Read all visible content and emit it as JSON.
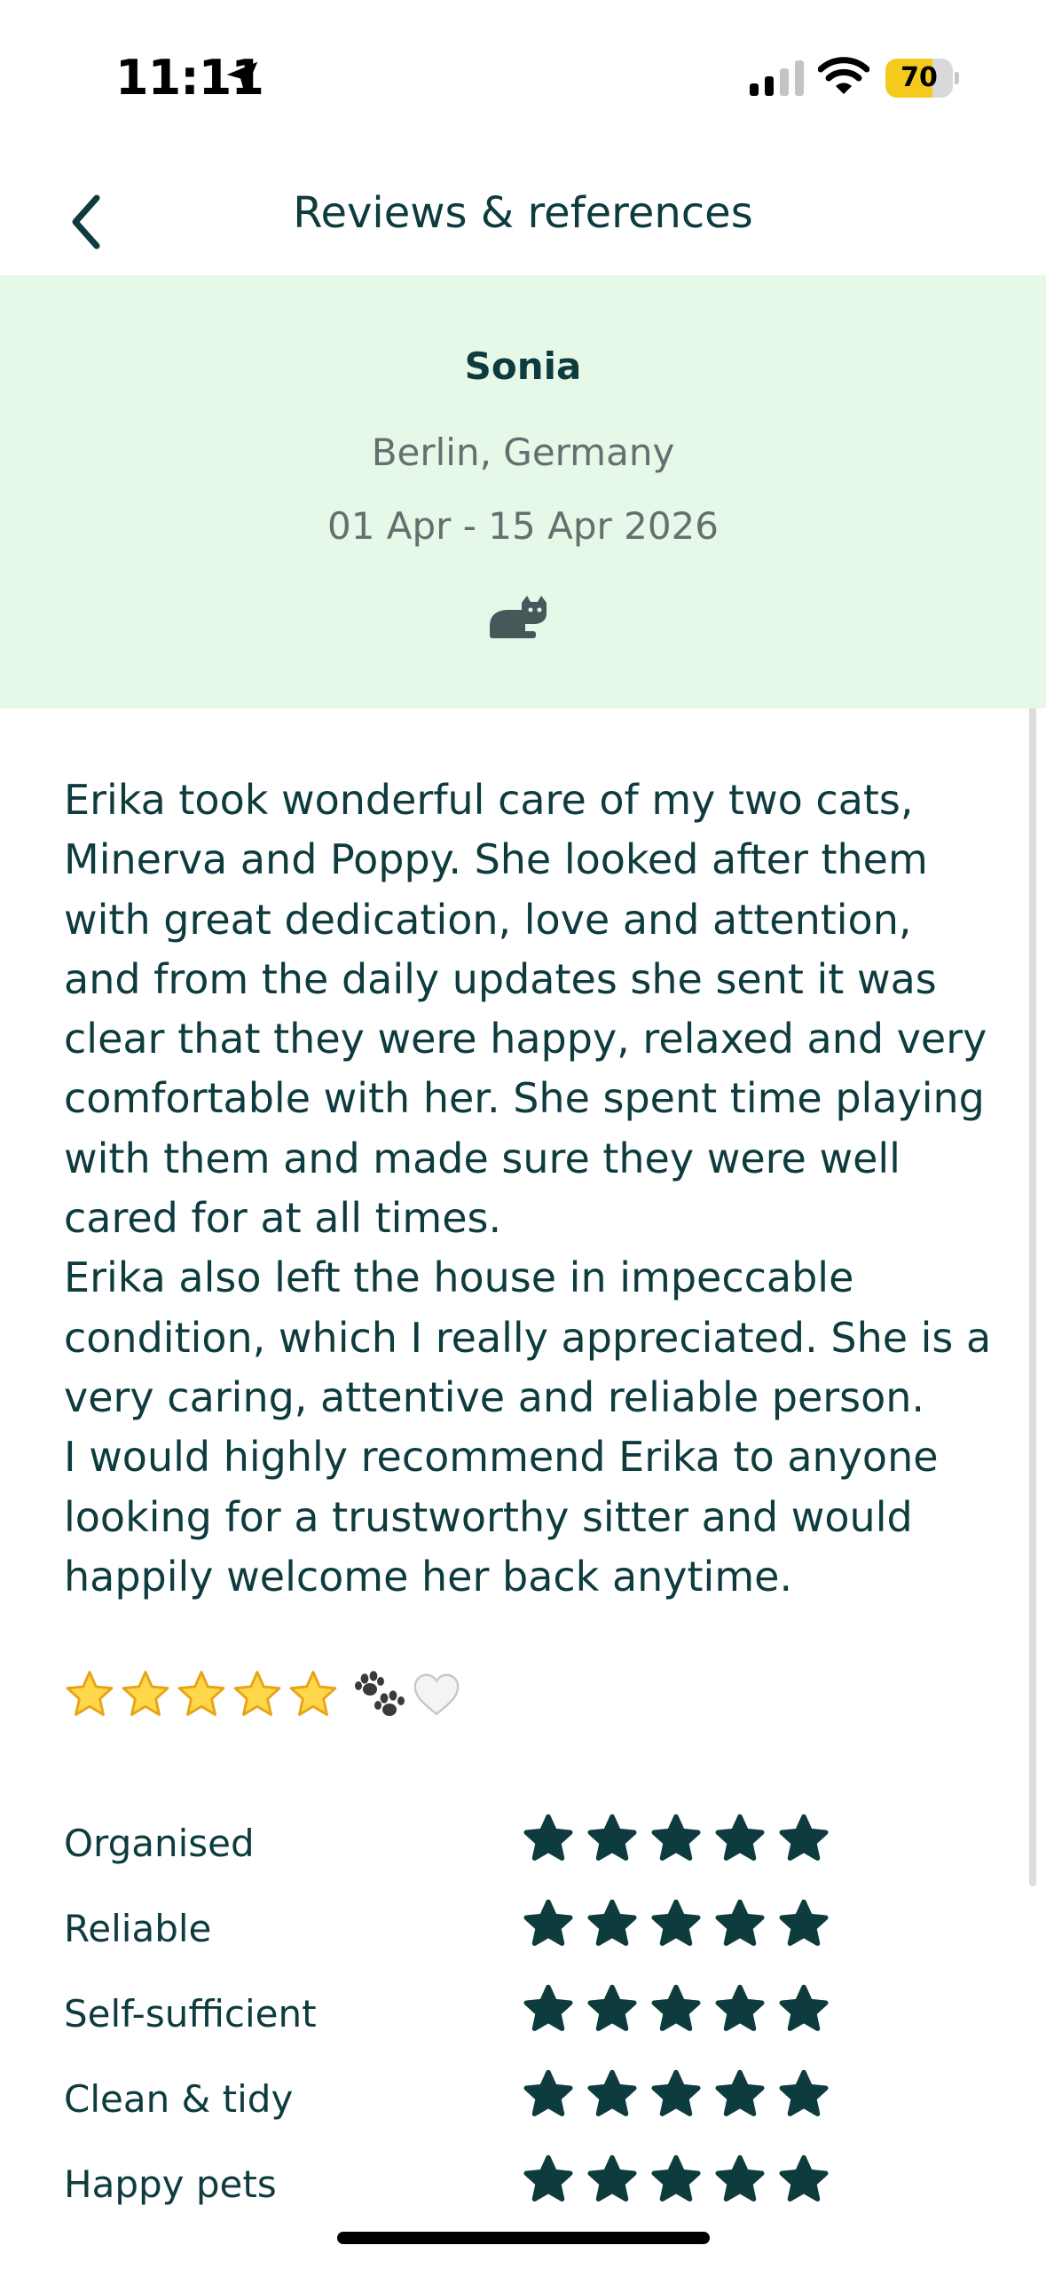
{
  "status_bar": {
    "time": "11:11",
    "battery": "70",
    "battery_level": 0.7
  },
  "nav": {
    "title": "Reviews & references"
  },
  "review": {
    "reviewer_name": "Sonia",
    "location": "Berlin, Germany",
    "dates": "01 Apr - 15 Apr 2026",
    "pet_icon": "cat-icon",
    "text": "Erika took wonderful care of my two cats, Minerva and Poppy. She looked after them with great dedication, love and attention, and from the daily updates she sent it was clear that they were happy, relaxed and very comfortable with her. She spent time playing with them and made sure they were well cared for at all times.\nErika also left the house in impeccable condition, which I really appreciated. She is a very caring, attentive and reliable person.\nI would highly recommend Erika to anyone looking for a trustworthy sitter and would happily welcome her back anytime.",
    "emoji": [
      "star-emoji",
      "star-emoji",
      "star-emoji",
      "star-emoji",
      "star-emoji",
      "paw-prints-emoji",
      "white-heart-emoji"
    ]
  },
  "ratings": [
    {
      "label": "Organised",
      "stars": 5,
      "max": 5
    },
    {
      "label": "Reliable",
      "stars": 5,
      "max": 5
    },
    {
      "label": "Self-sufficient",
      "stars": 5,
      "max": 5
    },
    {
      "label": "Clean & tidy",
      "stars": 5,
      "max": 5
    },
    {
      "label": "Happy pets",
      "stars": 5,
      "max": 5
    }
  ],
  "colors": {
    "primary_text": "#0d3b3e",
    "secondary_text": "#666f6f",
    "header_background": "#e6f8e8",
    "rating_star": "#0d3b3e",
    "battery_fill": "#f4ca1c"
  }
}
